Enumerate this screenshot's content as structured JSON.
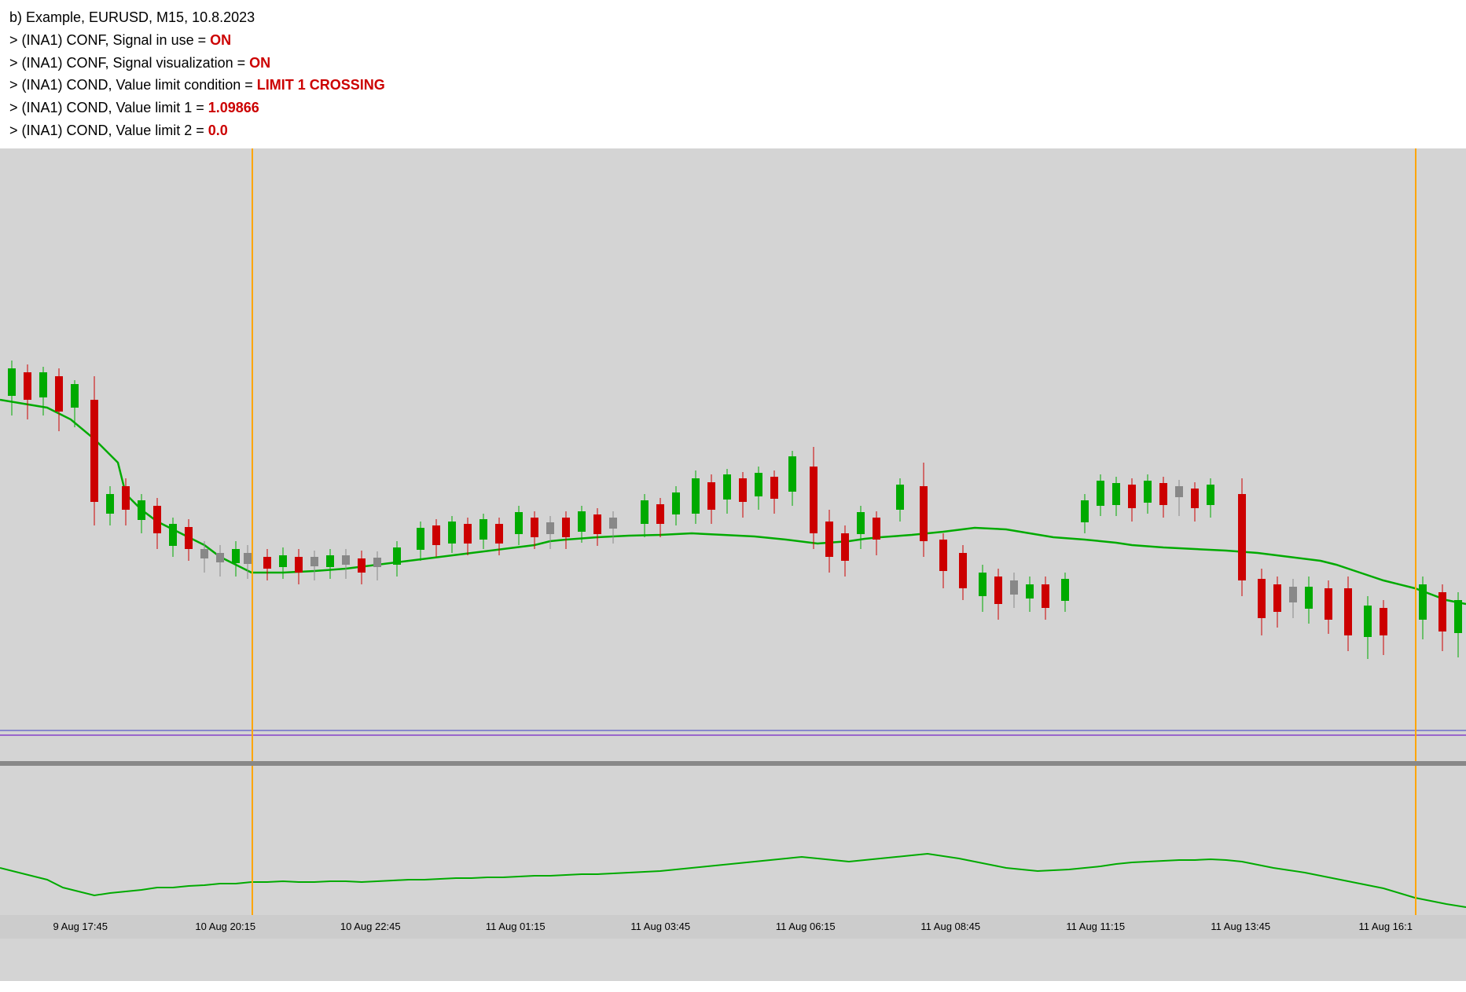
{
  "info": {
    "line1": "b) Example, EURUSD, M15, 10.8.2023",
    "line2_prefix": "> (INA1) CONF, Signal in use = ",
    "line2_value": "ON",
    "line3_prefix": "> (INA1) CONF, Signal visualization = ",
    "line3_value": "ON",
    "line4_prefix": "> (INA1) COND, Value limit condition = ",
    "line4_value": "LIMIT 1 CROSSING",
    "line5_prefix": "> (INA1) COND, Value limit 1 = ",
    "line5_value": "1.09866",
    "line6_prefix": "> (INA1) COND, Value limit 2 = ",
    "line6_value": "0.0"
  },
  "xaxis": {
    "labels": [
      "9 Aug 17:45",
      "10 Aug 20:15",
      "10 Aug 22:45",
      "11 Aug 01:15",
      "11 Aug 03:45",
      "11 Aug 06:15",
      "11 Aug 08:45",
      "11 Aug 11:15",
      "11 Aug 13:45",
      "11 Aug 16:1"
    ]
  },
  "colors": {
    "background": "#d4d4d4",
    "green_candle": "#00aa00",
    "red_candle": "#cc0000",
    "ma_line": "#00aa00",
    "orange_vline": "#FFA500",
    "purple_hline": "#9966cc",
    "separator": "#888888"
  }
}
